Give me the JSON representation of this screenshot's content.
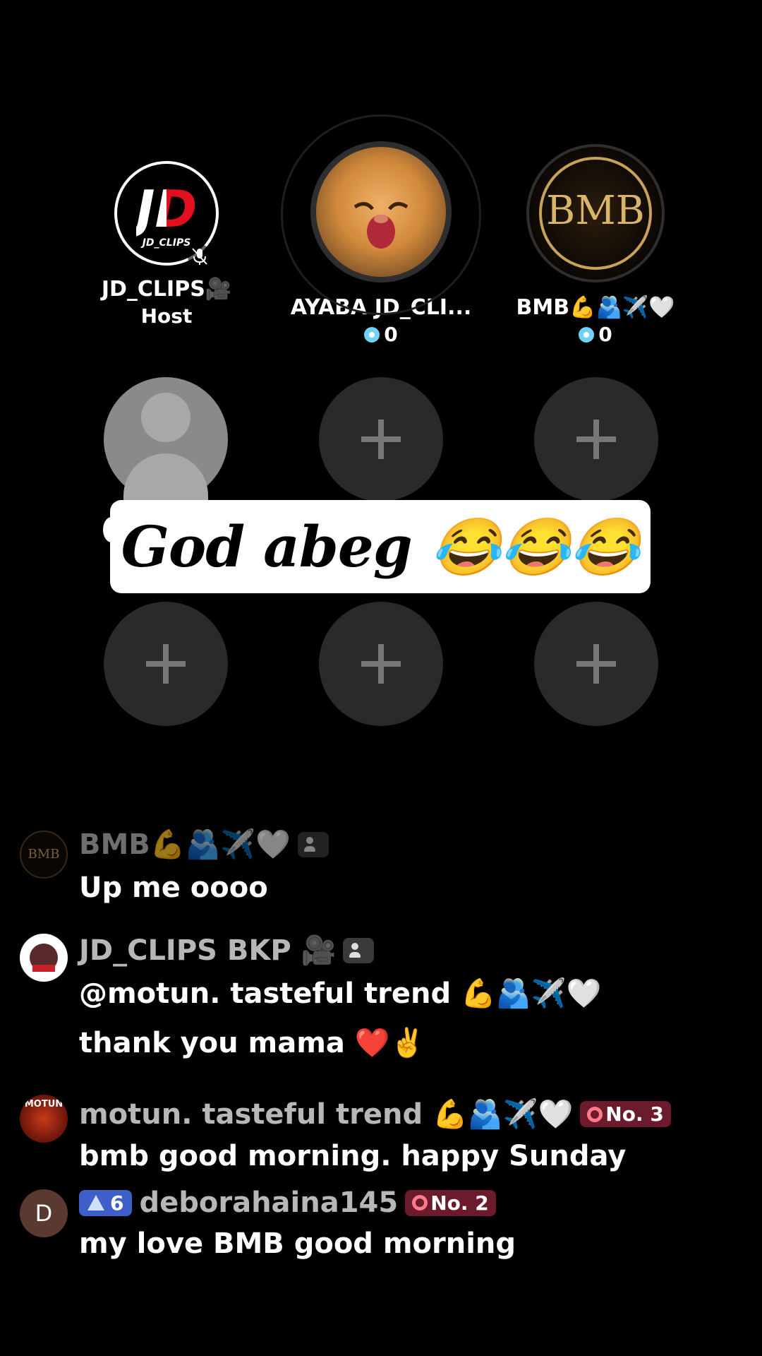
{
  "seats": [
    {
      "name": "JD_CLIPS🎥",
      "sub": "Host",
      "avatar_text": "JD",
      "avatar_subtext": "JD_CLIPS"
    },
    {
      "name": "AYABA JD_CLI...",
      "coins": "0"
    },
    {
      "name": "BMB💪🫂✈️🤍",
      "coins": "0",
      "avatar_text": "BMB"
    }
  ],
  "caption": "God abeg 😂😂😂",
  "chat": [
    {
      "name": "BMB💪🫂✈️🤍",
      "text": "Up me oooo",
      "avatar_text": "BMB"
    },
    {
      "name": "JD_CLIPS BKP 🎥",
      "text": "@motun. tasteful trend 💪🫂✈️🤍 thank you mama ❤️✌️"
    },
    {
      "name": "motun. tasteful trend 💪🫂✈️🤍",
      "badge": "No. 3",
      "text": "bmb good morning. happy Sunday",
      "avatar_text": "MOTUN"
    },
    {
      "name": "deborahaina145",
      "level": "6",
      "badge": "No. 2",
      "text": "my love BMB good morning",
      "avatar_text": "D"
    }
  ],
  "colors": {
    "background": "#000000",
    "empty_seat": "#2a2a2a",
    "rank_badge": "#6b1b2b",
    "level_badge": "#3f5fc8"
  }
}
